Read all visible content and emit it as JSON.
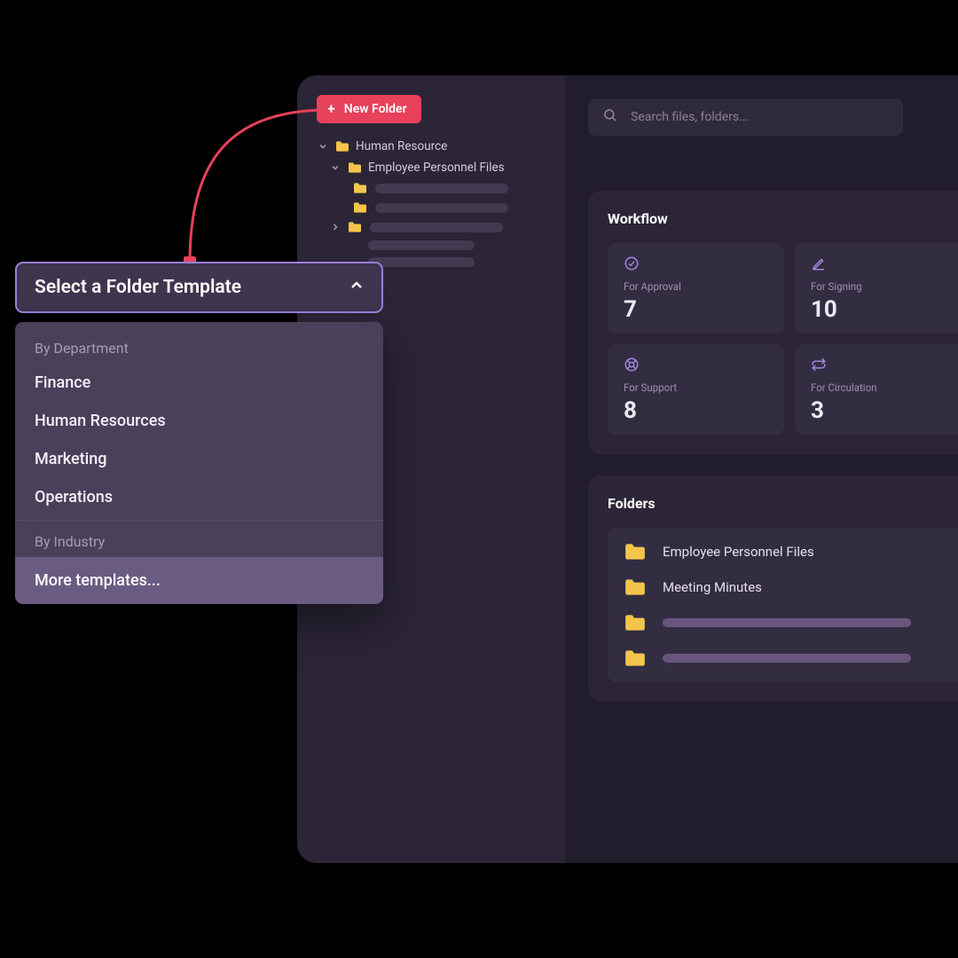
{
  "sidebar": {
    "new_folder_label": "New Folder",
    "tree": {
      "root": "Human Resource",
      "child": "Employee Personnel Files"
    }
  },
  "search": {
    "placeholder": "Search files, folders..."
  },
  "workflow": {
    "title": "Workflow",
    "cards": [
      {
        "label": "For Approval",
        "value": "7"
      },
      {
        "label": "For Signing",
        "value": "10"
      },
      {
        "label": "For Support",
        "value": "8"
      },
      {
        "label": "For Circulation",
        "value": "3"
      }
    ]
  },
  "folders": {
    "title": "Folders",
    "items": [
      "Employee Personnel Files",
      "Meeting Minutes"
    ]
  },
  "template_picker": {
    "title": "Select a Folder Template",
    "group1_label": "By Department",
    "group1_options": [
      "Finance",
      "Human Resources",
      "Marketing",
      "Operations"
    ],
    "group2_label": "By Industry",
    "more_label": "More templates..."
  }
}
